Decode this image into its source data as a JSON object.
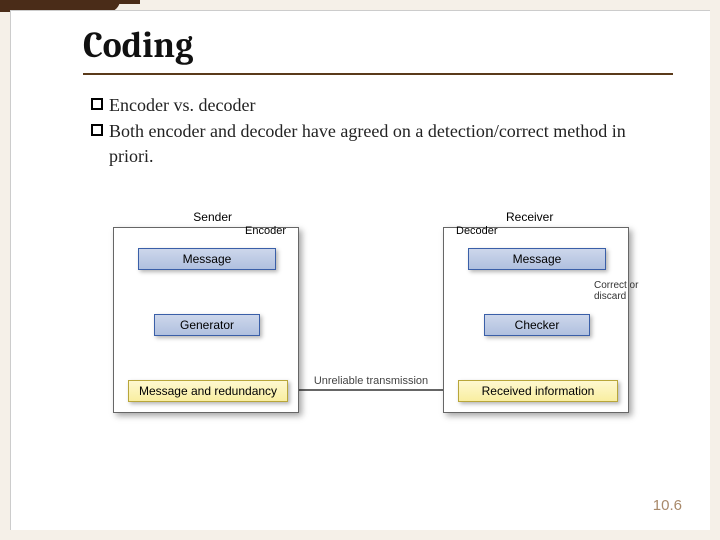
{
  "slide": {
    "title": "Coding",
    "bullets": [
      "Encoder  vs. decoder",
      "Both encoder  and decoder have agreed on a detection/correct method in priori."
    ],
    "page_number": "10.6"
  },
  "diagram": {
    "sender": {
      "group_label": "Sender",
      "role_label": "Encoder",
      "message": "Message",
      "generator": "Generator",
      "output": "Message and redundancy"
    },
    "receiver": {
      "group_label": "Receiver",
      "role_label": "Decoder",
      "message": "Message",
      "checker": "Checker",
      "input": "Received information",
      "discard_label": "Correct or discard"
    },
    "link_label": "Unreliable transmission"
  }
}
